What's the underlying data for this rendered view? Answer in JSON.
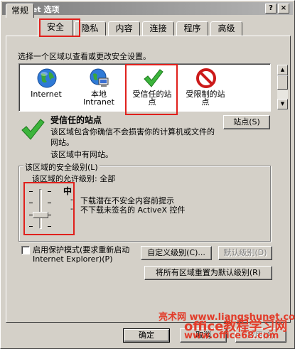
{
  "window": {
    "title": "Internet 选项",
    "help_label": "?",
    "close_label": "×"
  },
  "tabs": [
    {
      "label": "常规"
    },
    {
      "label": "安全"
    },
    {
      "label": "隐私"
    },
    {
      "label": "内容"
    },
    {
      "label": "连接"
    },
    {
      "label": "程序"
    },
    {
      "label": "高级"
    }
  ],
  "security": {
    "instruction": "选择一个区域以查看或更改安全设置。",
    "zones": [
      {
        "label": "Internet",
        "icon": "globe-icon"
      },
      {
        "label": "本地\nIntranet",
        "icon": "local-intranet-icon"
      },
      {
        "label": "受信任的站\n点",
        "icon": "checkmark-icon"
      },
      {
        "label": "受限制的站\n点",
        "icon": "restricted-icon"
      }
    ],
    "selected_zone_title": "受信任的站点",
    "selected_zone_desc": "该区域包含你确信不会损害你的计算机或文件的网站。",
    "selected_zone_desc2": "该区域中有网站。",
    "sites_button": "站点(S)",
    "level_group_label": "该区域的安全级别(L)",
    "allowed_levels": "该区域的允许级别: 全部",
    "level_name": "中",
    "level_desc": [
      "下载潜在不安全内容前提示",
      "不下载未签名的 ActiveX 控件"
    ],
    "protected_mode_label": "启用保护模式(要求重新启动 Internet Explorer)(P)",
    "custom_level_button": "自定义级别(C)...",
    "default_level_button": "默认级别(D)",
    "reset_all_button": "将所有区域重置为默认级别(R)"
  },
  "footer": {
    "ok_label": "确定",
    "cancel_label": "取消",
    "apply_label": "应用(A)"
  },
  "watermark": {
    "line1": "亮术网 www.liangshunet.com",
    "line2": "office教程学习网",
    "line3": "www.office68.com"
  },
  "colors": {
    "highlight_box": "#e0201c",
    "watermark": "#e23c2a"
  }
}
